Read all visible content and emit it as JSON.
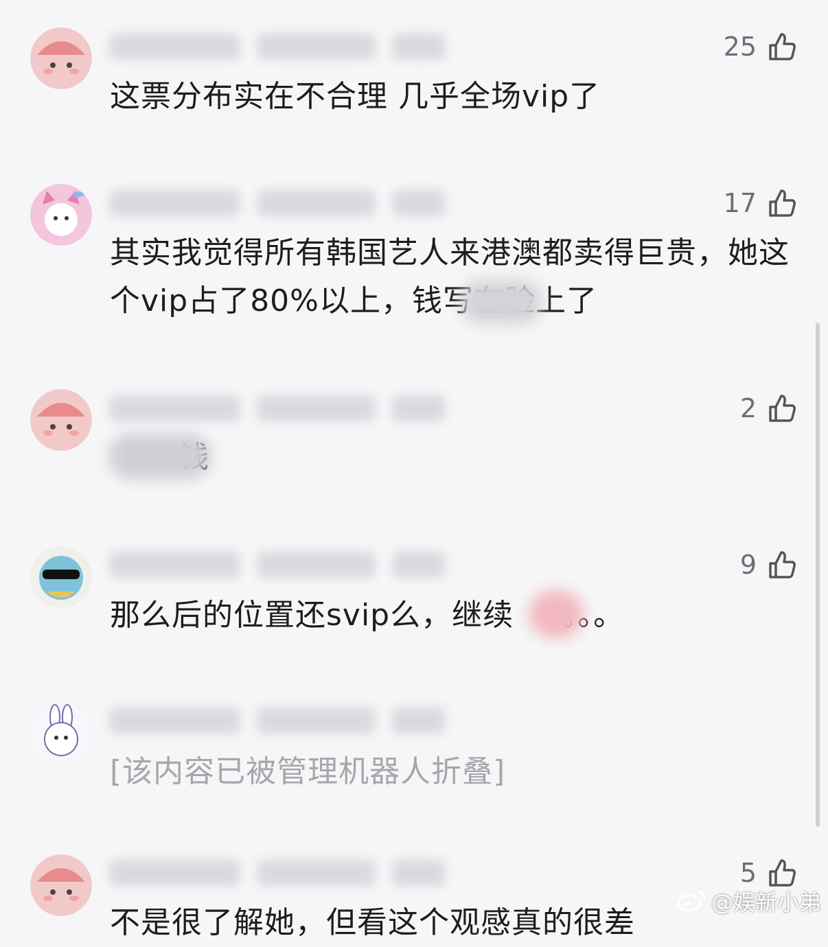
{
  "comments": [
    {
      "likes": "25",
      "text": "这票分布实在不合理 几乎全场vip了",
      "avatar": "pink-cartoon"
    },
    {
      "likes": "17",
      "text": "其实我觉得所有韩国艺人来港澳都卖得巨贵，她这个vip占了80%以上，",
      "text_tail": "钱写在脸上了",
      "avatar": "pink-cat"
    },
    {
      "likes": "2",
      "text": "钱",
      "avatar": "pink-cartoon"
    },
    {
      "likes": "9",
      "text": "那么后的位置还svip么，继续",
      "text_tail": "。。。",
      "avatar": "turtle-sunglasses"
    },
    {
      "likes": "",
      "text": "[该内容已被管理机器人折叠]",
      "avatar": "white-bunny"
    },
    {
      "likes": "5",
      "text": "不是很了解她，但看这个观感真的很差",
      "avatar": "pink-cartoon"
    }
  ],
  "watermark": "@娱新小弟",
  "colors": {
    "background": "#f6f6f8",
    "text": "#1d1d1f",
    "muted": "#a6a6ab",
    "like": "#6d6d73"
  }
}
